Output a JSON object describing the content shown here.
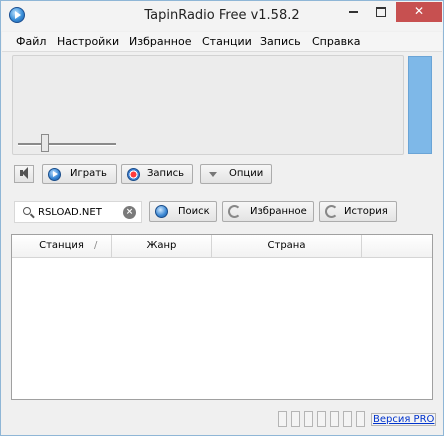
{
  "window": {
    "title": "TapinRadio Free v1.58.2",
    "controls": {
      "minimize": "",
      "maximize": "",
      "close": "✕"
    }
  },
  "menu": {
    "items": [
      "Файл",
      "Настройки",
      "Избранное",
      "Станции",
      "Запись",
      "Справка"
    ]
  },
  "player": {
    "volume_level": 0.28,
    "buttons": {
      "play": "Играть",
      "record": "Запись",
      "options": "Опции"
    }
  },
  "search": {
    "value": "RSLOAD.NET",
    "buttons": {
      "search": "Поиск",
      "favorites": "Избранное",
      "history": "История"
    }
  },
  "table": {
    "columns": [
      "Станция",
      "Жанр",
      "Страна"
    ],
    "rows": []
  },
  "statusbar": {
    "pro_link": "Версия PRO"
  },
  "colors": {
    "accent": "#7eb8e8",
    "close_button": "#c75050",
    "link": "#0033cc"
  }
}
